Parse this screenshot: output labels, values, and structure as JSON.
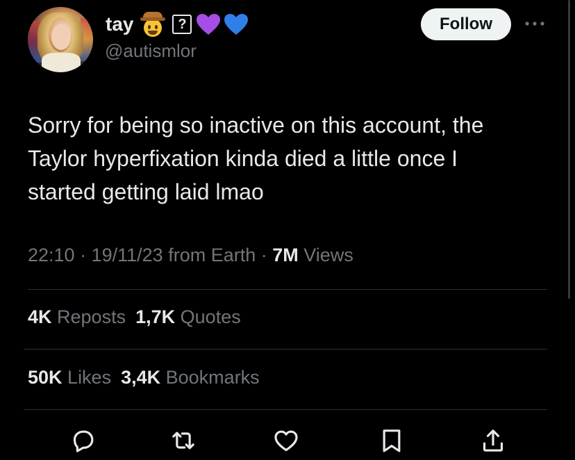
{
  "author": {
    "display_name": "tay",
    "handle": "@autismlor",
    "name_emojis": [
      "cowboy-hat-face",
      "unknown-glyph-box",
      "purple-heart",
      "blue-heart"
    ],
    "unknown_glyph": "?"
  },
  "header": {
    "follow_label": "Follow",
    "more_icon": "more-horizontal-icon"
  },
  "tweet": {
    "text": "Sorry for being so inactive on this account, the\nTaylor hyperfixation kinda died a little once I\nstarted getting laid lmao",
    "time": "22:10",
    "date": "19/11/23",
    "sep": " · ",
    "source": "from Earth",
    "views_count": "7M",
    "views_label": "Views"
  },
  "stats": {
    "reposts_count": "4K",
    "reposts_label": "Reposts",
    "quotes_count": "1,7K",
    "quotes_label": "Quotes",
    "likes_count": "50K",
    "likes_label": "Likes",
    "bookmarks_count": "3,4K",
    "bookmarks_label": "Bookmarks"
  },
  "actions": [
    "reply-icon",
    "repost-icon",
    "like-icon",
    "bookmark-icon",
    "share-icon"
  ],
  "colors": {
    "background": "#000000",
    "text_primary": "#e7e9ea",
    "text_secondary": "#71767b",
    "divider": "#2f3336",
    "follow_bg": "#eff3f4",
    "follow_text": "#0f1419",
    "purple_heart": "#a64de6",
    "blue_heart": "#2f7fe8"
  }
}
